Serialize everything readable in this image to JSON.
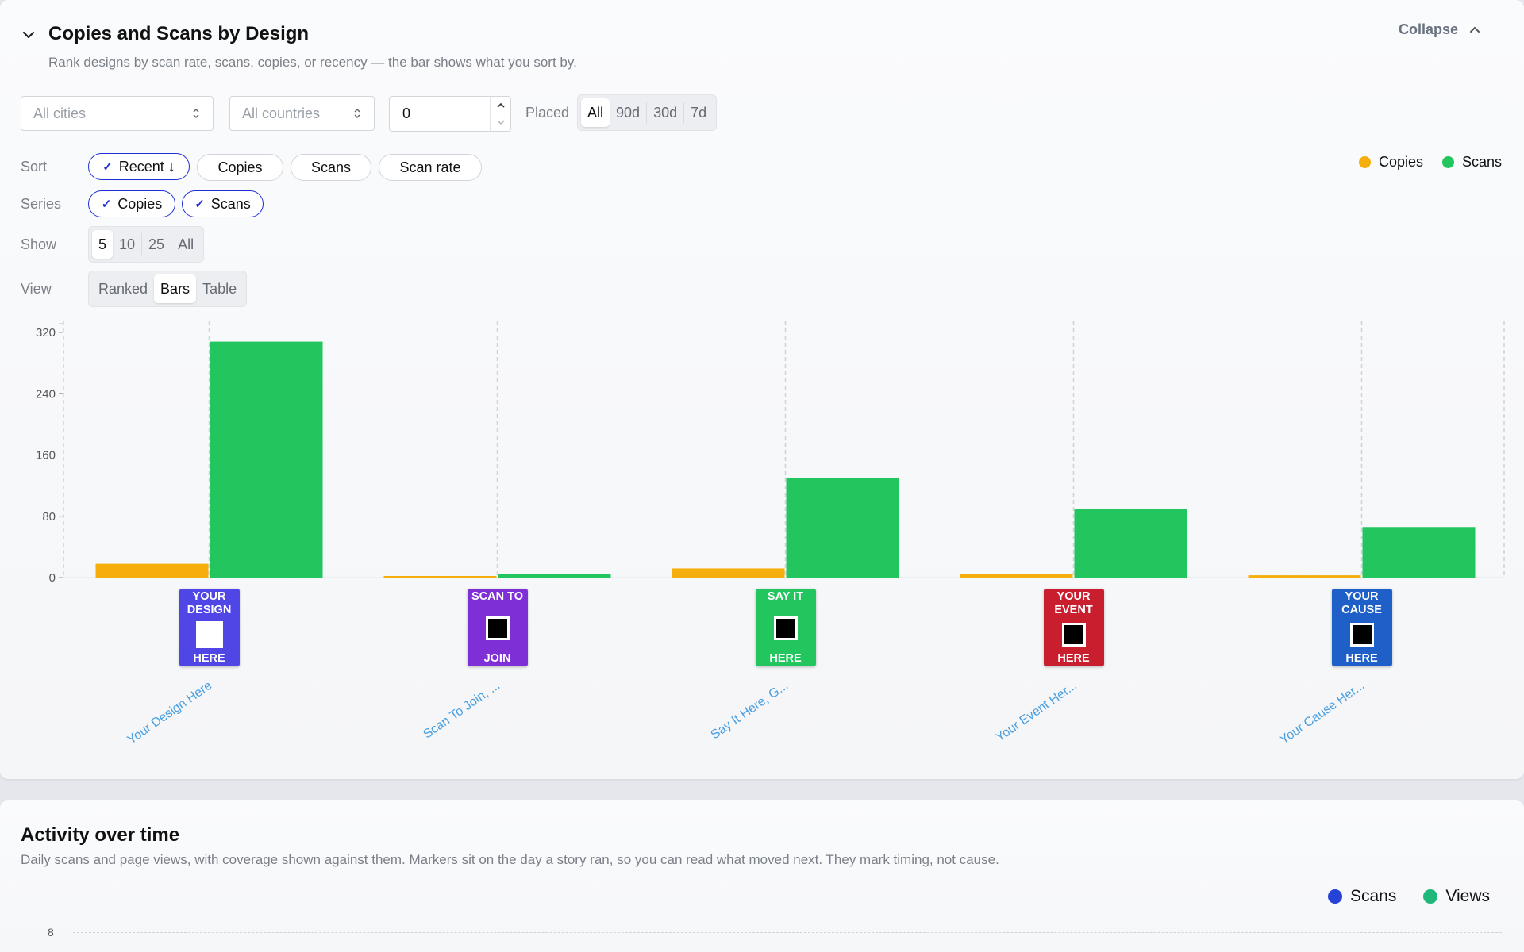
{
  "card1": {
    "title": "Copies and Scans by Design",
    "subtitle": "Rank designs by scan rate, scans, copies, or recency — the bar shows what you sort by.",
    "collapse_label": "Collapse",
    "filters": {
      "cities_placeholder": "All cities",
      "countries_placeholder": "All countries",
      "min_value": "0",
      "placed_label": "Placed",
      "placed_options": [
        "All",
        "90d",
        "30d",
        "7d"
      ],
      "placed_selected": "All"
    },
    "sort": {
      "label": "Sort",
      "options": [
        "Recent ↓",
        "Copies",
        "Scans",
        "Scan rate"
      ],
      "selected": "Recent ↓"
    },
    "series": {
      "label": "Series",
      "options": [
        "Copies",
        "Scans"
      ]
    },
    "show": {
      "label": "Show",
      "options": [
        "5",
        "10",
        "25",
        "All"
      ],
      "selected": "5"
    },
    "view": {
      "label": "View",
      "options": [
        "Ranked",
        "Bars",
        "Table"
      ],
      "selected": "Bars"
    },
    "legend": [
      {
        "name": "Copies",
        "color": "#f5ae0b"
      },
      {
        "name": "Scans",
        "color": "#22c55e"
      }
    ],
    "posters": [
      {
        "top": "YOUR DESIGN",
        "bottom": "HERE",
        "color": "#4f46e5",
        "has_qr": false,
        "link": "Your Design Here"
      },
      {
        "top": "SCAN TO",
        "bottom": "JOIN",
        "color": "#7e2fd6",
        "has_qr": true,
        "link": "Scan To Join, ..."
      },
      {
        "top": "SAY IT",
        "bottom": "HERE",
        "color": "#22c55e",
        "has_qr": true,
        "link": "Say It Here, G..."
      },
      {
        "top": "YOUR EVENT",
        "bottom": "HERE",
        "color": "#c81e2e",
        "has_qr": true,
        "link": "Your Event Her..."
      },
      {
        "top": "YOUR CAUSE",
        "bottom": "HERE",
        "color": "#1f5fc8",
        "has_qr": true,
        "link": "Your Cause Her..."
      }
    ]
  },
  "chart_data": {
    "type": "bar",
    "categories": [
      "Your Design Here",
      "Scan To Join, ...",
      "Say It Here, G...",
      "Your Event Her...",
      "Your Cause Her..."
    ],
    "series": [
      {
        "name": "Copies",
        "color": "#f5ae0b",
        "values": [
          18,
          1,
          12,
          5,
          3
        ]
      },
      {
        "name": "Scans",
        "color": "#22c55e",
        "values": [
          308,
          5,
          130,
          90,
          66
        ]
      }
    ],
    "yticks": [
      "0",
      "80",
      "160",
      "240",
      "320"
    ],
    "ylim": [
      0,
      320
    ],
    "legend_position": "top-right"
  },
  "card2": {
    "title": "Activity over time",
    "subtitle": "Daily scans and page views, with coverage shown against them. Markers sit on the day a story ran, so you can read what moved next. They mark timing, not cause.",
    "legend": [
      {
        "name": "Scans",
        "color": "#2642d8"
      },
      {
        "name": "Views",
        "color": "#1fb87a"
      }
    ],
    "ytick_top": "8"
  }
}
